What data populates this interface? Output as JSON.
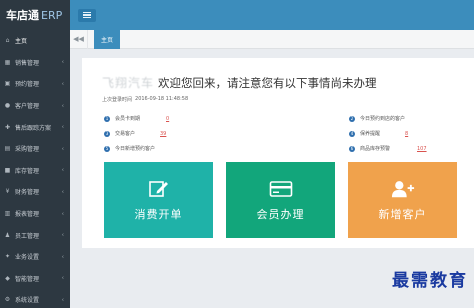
{
  "app": {
    "logo_text": "车店通",
    "logo_suffix": "ERP"
  },
  "sidebar": {
    "items": [
      {
        "label": "主页",
        "icon": "home-icon"
      },
      {
        "label": "销售管理",
        "icon": "cart-icon"
      },
      {
        "label": "预约管理",
        "icon": "calendar-icon"
      },
      {
        "label": "客户管理",
        "icon": "user-icon"
      },
      {
        "label": "售后跟踪方案",
        "icon": "tools-icon"
      },
      {
        "label": "采购管理",
        "icon": "truck-icon"
      },
      {
        "label": "库存管理",
        "icon": "box-icon"
      },
      {
        "label": "财务管理",
        "icon": "money-icon"
      },
      {
        "label": "报表管理",
        "icon": "chart-icon"
      },
      {
        "label": "员工管理",
        "icon": "staff-icon"
      },
      {
        "label": "业务设置",
        "icon": "gear-icon"
      },
      {
        "label": "智能管理",
        "icon": "smart-icon"
      },
      {
        "label": "系统设置",
        "icon": "cog-icon"
      }
    ]
  },
  "tabs": {
    "back_glyph": "◀◀",
    "home_label": "主页"
  },
  "welcome": {
    "name_blurred": "飞翔汽车",
    "message": "欢迎您回来，请注意您有以下事情尚未办理",
    "last_login_label": "上次登录时间",
    "last_login_value": "2016-09-18 11:48:58"
  },
  "stats": {
    "left": [
      {
        "no": "1",
        "label": "会员卡到期",
        "value": "0"
      },
      {
        "no": "3",
        "label": "交易客户",
        "value": "39"
      },
      {
        "no": "5",
        "label": "今日新增预约客户",
        "value": ""
      }
    ],
    "right": [
      {
        "no": "2",
        "label": "今日预约到店的客户",
        "value": ""
      },
      {
        "no": "4",
        "label": "保养提醒",
        "value": "8"
      },
      {
        "no": "6",
        "label": "商品库存预警",
        "value": "107"
      }
    ]
  },
  "tiles": [
    {
      "label": "消费开单",
      "icon": "edit-icon",
      "color": "#1fb2a8"
    },
    {
      "label": "会员办理",
      "icon": "card-icon",
      "color": "#12a67b"
    },
    {
      "label": "新增客户",
      "icon": "add-user-icon",
      "color": "#f0a24c"
    }
  ],
  "watermark": "最需教育",
  "colors": {
    "sidebar_bg": "#2d3841",
    "topbar_bg": "#3c8dbc",
    "accent_red": "#d9534f"
  }
}
